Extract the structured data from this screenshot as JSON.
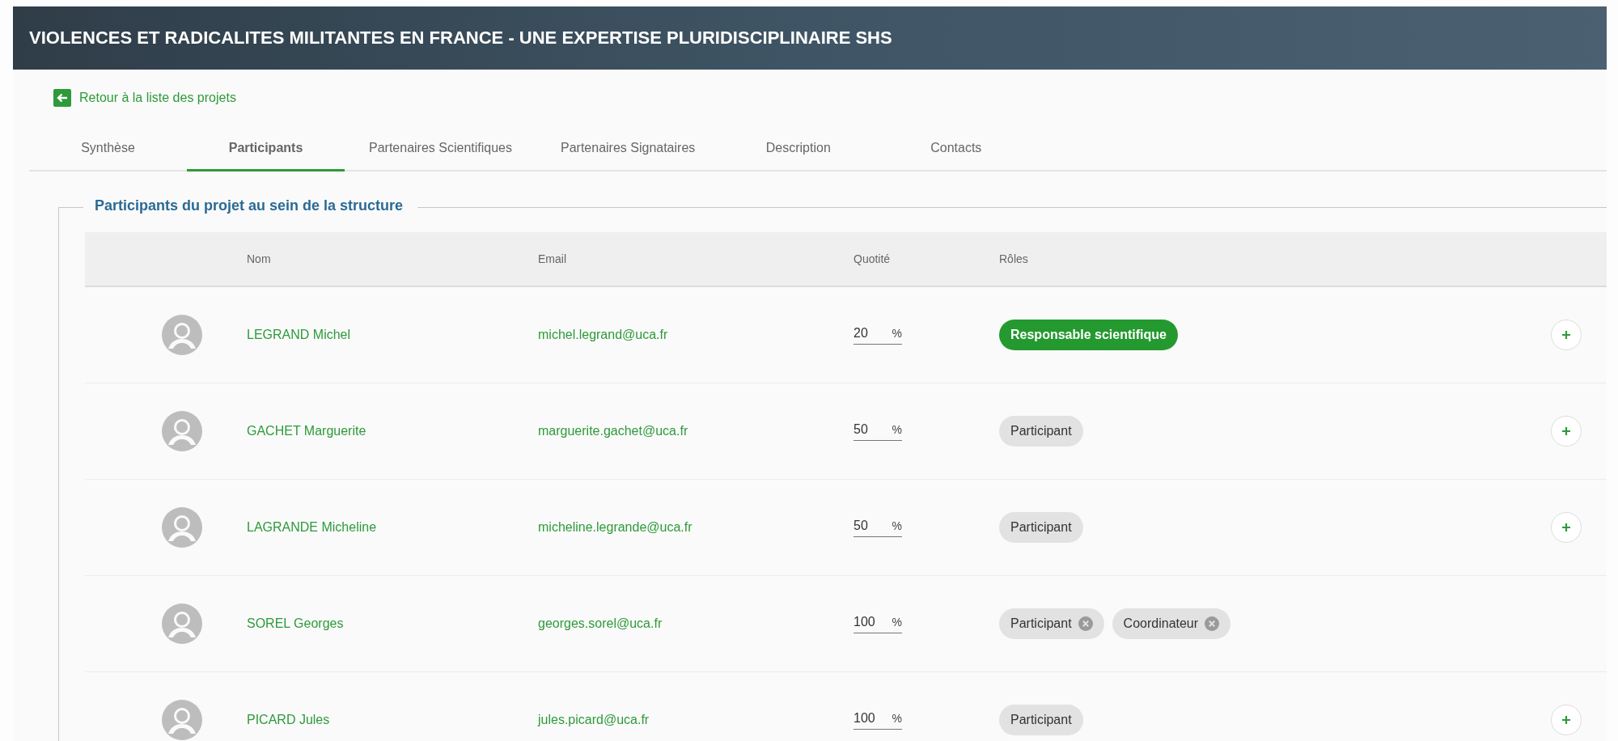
{
  "header": {
    "title": "VIOLENCES ET RADICALITES MILITANTES EN FRANCE - UNE EXPERTISE PLURIDISCIPLINAIRE SHS"
  },
  "back_link": {
    "label": "Retour à la liste des projets"
  },
  "tabs": [
    {
      "label": "Synthèse",
      "selected": false
    },
    {
      "label": "Participants",
      "selected": true
    },
    {
      "label": "Partenaires Scientifiques",
      "selected": false
    },
    {
      "label": "Partenaires Signataires",
      "selected": false
    },
    {
      "label": "Description",
      "selected": false
    },
    {
      "label": "Contacts",
      "selected": false
    }
  ],
  "section": {
    "title": "Participants du projet au sein de la structure",
    "table": {
      "columns": [
        "Nom",
        "Email",
        "Quotité",
        "Rôles"
      ],
      "rows": [
        {
          "name": "LEGRAND Michel",
          "email": "michel.legrand@uca.fr",
          "quotite": "20",
          "unit": "%",
          "roles": [
            {
              "label": "Responsable scientifique",
              "kind": "primary",
              "removable": false
            }
          ],
          "addable": true
        },
        {
          "name": "GACHET Marguerite",
          "email": "marguerite.gachet@uca.fr",
          "quotite": "50",
          "unit": "%",
          "roles": [
            {
              "label": "Participant",
              "kind": "default",
              "removable": false
            }
          ],
          "addable": true
        },
        {
          "name": "LAGRANDE Micheline",
          "email": "micheline.legrande@uca.fr",
          "quotite": "50",
          "unit": "%",
          "roles": [
            {
              "label": "Participant",
              "kind": "default",
              "removable": false
            }
          ],
          "addable": true
        },
        {
          "name": "SOREL Georges",
          "email": "georges.sorel@uca.fr",
          "quotite": "100",
          "unit": "%",
          "roles": [
            {
              "label": "Participant",
              "kind": "default",
              "removable": true
            },
            {
              "label": "Coordinateur",
              "kind": "default",
              "removable": true
            }
          ],
          "addable": false
        },
        {
          "name": "PICARD Jules",
          "email": "jules.picard@uca.fr",
          "quotite": "100",
          "unit": "%",
          "roles": [
            {
              "label": "Participant",
              "kind": "default",
              "removable": false
            }
          ],
          "addable": true
        }
      ]
    }
  }
}
